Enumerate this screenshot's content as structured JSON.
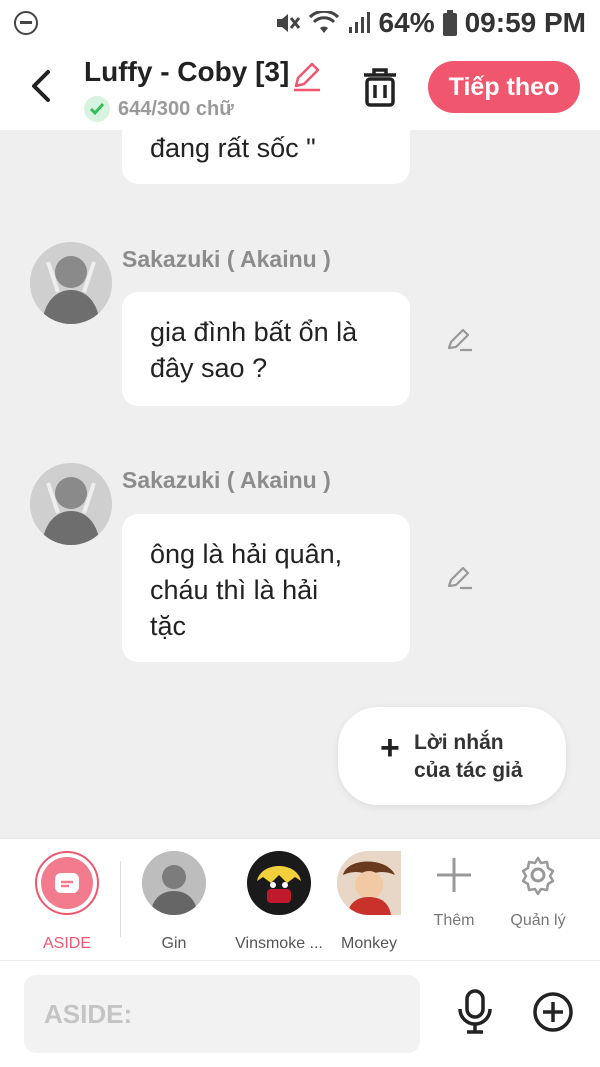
{
  "status_bar": {
    "battery_percent": "64%",
    "time": "09:59 PM"
  },
  "header": {
    "title": "Luffy - Coby [3]",
    "word_count": "644/300 chữ",
    "next_button": "Tiếp theo"
  },
  "messages": [
    {
      "id": "partial",
      "text": "đang rất sốc \""
    },
    {
      "id": "m1",
      "sender": "Sakazuki ( Akainu )",
      "lines": [
        "gia đình bất ổn là",
        "đây sao ?"
      ]
    },
    {
      "id": "m2",
      "sender": "Sakazuki ( Akainu )",
      "lines": [
        "ông là hải quân,",
        "cháu thì là hải",
        "tặc"
      ]
    }
  ],
  "author_note": {
    "line1": "Lời nhắn",
    "line2": "của tác giả"
  },
  "characters": [
    {
      "label": "ASIDE",
      "selected": true
    },
    {
      "label": "Gin"
    },
    {
      "label": "Vinsmoke ..."
    },
    {
      "label": "Monkey"
    }
  ],
  "tools": {
    "add_label": "Thêm",
    "manage_label": "Quản lý"
  },
  "input": {
    "placeholder": "ASIDE:"
  },
  "colors": {
    "accent": "#f0566e",
    "background": "#efefef",
    "bubble": "#ffffff"
  }
}
